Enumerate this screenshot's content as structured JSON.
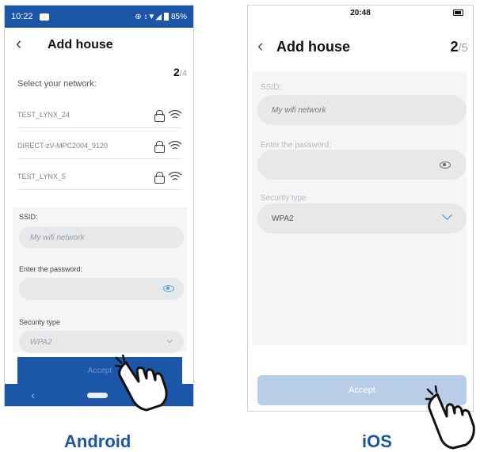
{
  "android": {
    "status": {
      "time": "10:22",
      "battery": "85%"
    },
    "title": "Add house",
    "step": {
      "current": "2",
      "total": "/4"
    },
    "subtitle": "Select your network:",
    "networks": [
      {
        "name": "TEST_LYNX_24"
      },
      {
        "name": "DIRECT-zV-MPC2004_9120"
      },
      {
        "name": "TEST_LYNX_5"
      }
    ],
    "ssid": {
      "label": "SSID:",
      "placeholder": "My wifi network"
    },
    "password": {
      "label": "Enter the password:",
      "value": ""
    },
    "security": {
      "label": "Security type",
      "value": "WPA2"
    },
    "accept_label": "Accept",
    "nav": {
      "back": "‹"
    },
    "caption": "Android",
    "colors": {
      "brand": "#1b56a8",
      "eye": "#3aa8e8"
    }
  },
  "ios": {
    "status": {
      "time": "20:48"
    },
    "title": "Add house",
    "step": {
      "current": "2",
      "total": "/5"
    },
    "ssid": {
      "label": "SSID:",
      "value": "My wifi network"
    },
    "password": {
      "label": "Enter the password:",
      "value": ""
    },
    "security": {
      "label": "Security type",
      "value": "WPA2"
    },
    "accept_label": "Accept",
    "caption": "iOS",
    "colors": {
      "accept_disabled": "#b9cde7",
      "chevron": "#3a8fd8"
    }
  },
  "icons": [
    "back-chevron-icon",
    "lock-icon",
    "wifi-icon",
    "eye-icon",
    "chevron-down-icon",
    "pointing-hand-icon"
  ]
}
